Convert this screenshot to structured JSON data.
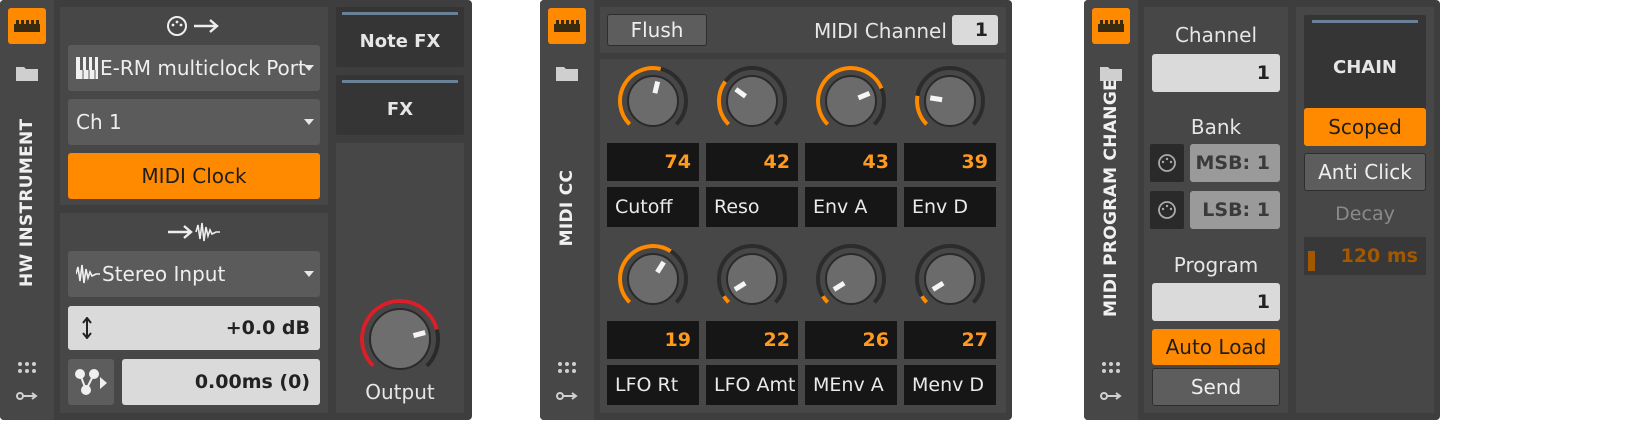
{
  "hw_instrument": {
    "title": "HW INSTRUMENT",
    "midi_out_port": "E-RM multiclock Port",
    "midi_channel": "Ch 1",
    "midi_clock_label": "MIDI Clock",
    "audio_input": "Stereo Input",
    "gain": "+0.0 dB",
    "latency": "0.00ms (0)",
    "note_fx_label": "Note FX",
    "fx_label": "FX",
    "output_label": "Output",
    "output_knob_value": 0.78
  },
  "midi_cc": {
    "title": "MIDI CC",
    "flush_label": "Flush",
    "midi_channel_label": "MIDI Channel",
    "midi_channel_value": "1",
    "controls": [
      {
        "label": "Cutoff",
        "value": "74",
        "knob": 0.55
      },
      {
        "label": "Reso",
        "value": "42",
        "knob": 0.3
      },
      {
        "label": "Env A",
        "value": "43",
        "knob": 0.75
      },
      {
        "label": "Env D",
        "value": "39",
        "knob": 0.2
      },
      {
        "label": "LFO Rt",
        "value": "19",
        "knob": 0.62
      },
      {
        "label": "LFO Amt",
        "value": "22",
        "knob": 0.05
      },
      {
        "label": "MEnv A",
        "value": "26",
        "knob": 0.05
      },
      {
        "label": "Menv D",
        "value": "27",
        "knob": 0.05
      }
    ]
  },
  "midi_program_change": {
    "title": "MIDI PROGRAM CHANGE",
    "channel_label": "Channel",
    "channel_value": "1",
    "bank_label": "Bank",
    "msb_value": "MSB: 1",
    "lsb_value": "LSB: 1",
    "program_label": "Program",
    "program_value": "1",
    "auto_load_label": "Auto Load",
    "send_label": "Send",
    "chain_label": "CHAIN",
    "scoped_label": "Scoped",
    "anti_click_label": "Anti Click",
    "decay_label": "Decay",
    "decay_value": "120 ms",
    "decay_level": 0.1
  },
  "colors": {
    "accent": "#ff8a00",
    "value_text": "#ff9a1f",
    "output_arc": "#d8202a"
  },
  "icons": {
    "device_icon": "keyboard-piano-icon",
    "preset_icon": "folder-icon",
    "remote_icon": "grid-dots-icon",
    "modulator_icon": "key-arrow-icon"
  }
}
